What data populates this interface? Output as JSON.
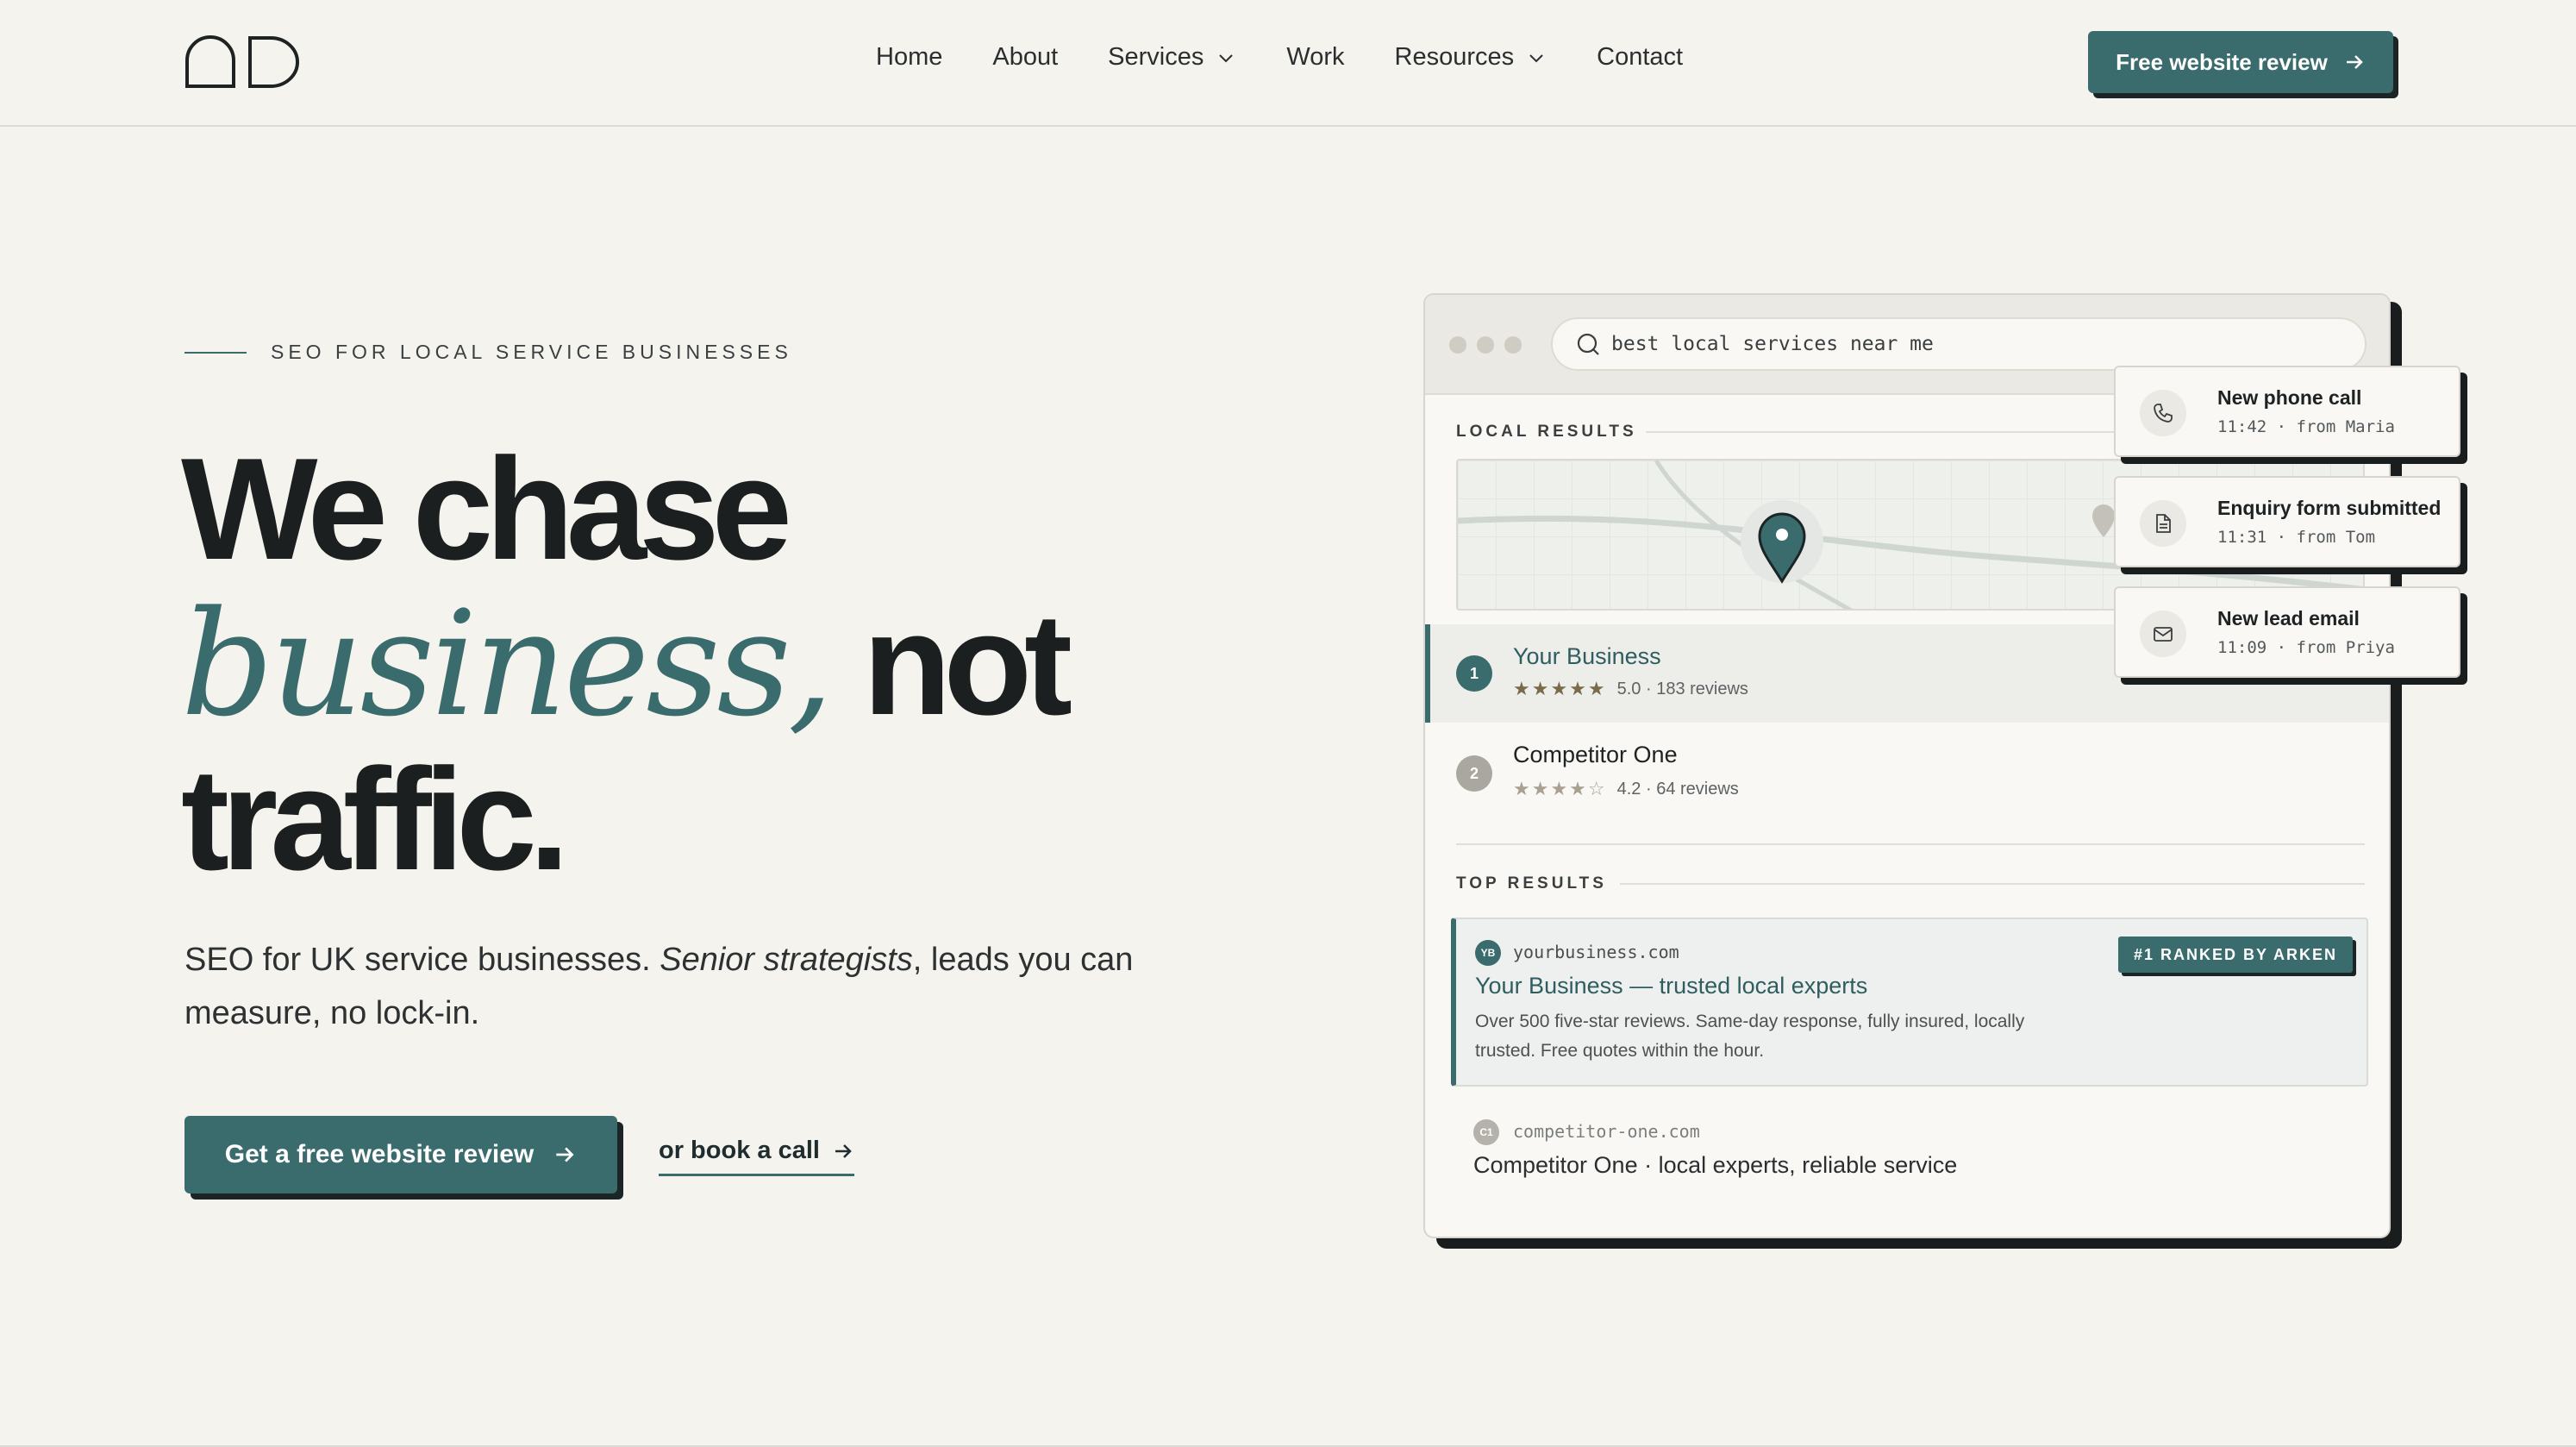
{
  "nav": {
    "links": [
      {
        "label": "Home",
        "dropdown": false
      },
      {
        "label": "About",
        "dropdown": false
      },
      {
        "label": "Services",
        "dropdown": true
      },
      {
        "label": "Work",
        "dropdown": false
      },
      {
        "label": "Resources",
        "dropdown": true
      },
      {
        "label": "Contact",
        "dropdown": false
      }
    ],
    "cta_label": "Free website review"
  },
  "hero": {
    "eyebrow": "SEO FOR LOCAL SERVICE BUSINESSES",
    "headline_1": "We chase",
    "headline_em": "business,",
    "headline_2": " not",
    "headline_3": "traffic.",
    "sub_1": "SEO for UK service businesses. ",
    "sub_em": "Senior strategists",
    "sub_2": ", leads you can measure, no lock-in.",
    "cta_label": "Get a free website review",
    "secondary_label": "or book a call"
  },
  "mock": {
    "search_query": "best local services near me",
    "local_label": "LOCAL RESULTS",
    "local_results": [
      {
        "rank": "1",
        "name": "Your Business",
        "stars": "★★★★★",
        "meta": "5.0 · 183 reviews"
      },
      {
        "rank": "2",
        "name": "Competitor One",
        "stars": "★★★★☆",
        "meta": "4.2 · 64 reviews"
      }
    ],
    "top_label": "TOP RESULTS",
    "top_results": [
      {
        "favicon": "YB",
        "url": "yourbusiness.com",
        "title": "Your Business — trusted local experts",
        "desc": "Over 500 five-star reviews. Same-day response, fully insured, locally trusted. Free quotes within the hour.",
        "badge": "#1 RANKED BY ARKEN"
      },
      {
        "favicon": "C1",
        "url": "competitor-one.com",
        "title": "Competitor One · local experts, reliable service"
      }
    ]
  },
  "notifications": [
    {
      "icon": "phone-icon",
      "title": "New phone call",
      "meta": "11:42 · from Maria"
    },
    {
      "icon": "document-icon",
      "title": "Enquiry form submitted",
      "meta": "11:31 · from Tom"
    },
    {
      "icon": "mail-icon",
      "title": "New lead email",
      "meta": "11:09 · from Priya"
    }
  ],
  "colors": {
    "accent": "#3a6b6d",
    "background": "#f4f3ee",
    "ink": "#1c1f20"
  }
}
